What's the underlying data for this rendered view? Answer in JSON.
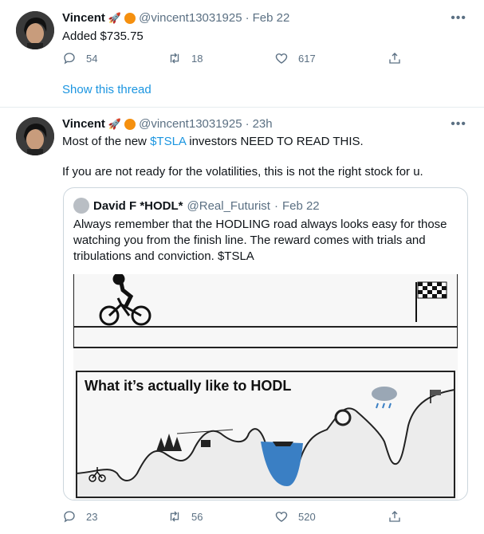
{
  "tweet1": {
    "name": "Vincent",
    "emoji": "🚀",
    "handle": "@vincent13031925",
    "sep": "·",
    "time": "Feb 22",
    "text": "Added $735.75",
    "replies": "54",
    "retweets": "18",
    "likes": "617",
    "more": "•••"
  },
  "show_thread": "Show this thread",
  "tweet2": {
    "name": "Vincent",
    "emoji": "🚀",
    "handle": "@vincent13031925",
    "sep": "·",
    "time": "23h",
    "text_pre": "Most of the new ",
    "ticker": "$TSLA",
    "text_post": " investors NEED TO READ THIS.",
    "text2": "If you are not ready for the volatilities, this is not the right stock for u.",
    "replies": "23",
    "retweets": "56",
    "likes": "520",
    "more": "•••"
  },
  "quote": {
    "name": "David F *HODL*",
    "handle": "@Real_Futurist",
    "sep": "·",
    "time": "Feb 22",
    "text": "Always remember that the HODLING road always looks easy for those watching you from the finish line. The reward comes with trials and tribulations and conviction. $TSLA",
    "meme_caption": "What it’s actually like to HODL"
  },
  "colors": {
    "link": "#1b95e0",
    "muted": "#5b7083",
    "badge": "#f5900f"
  }
}
